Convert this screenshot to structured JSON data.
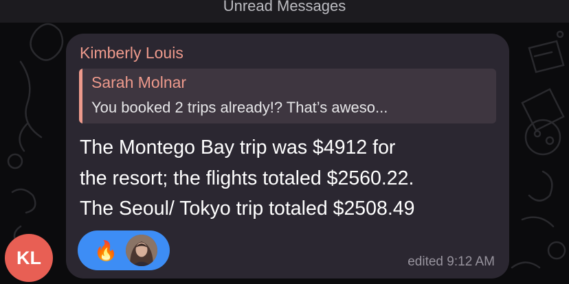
{
  "unread_bar": {
    "label": "Unread Messages"
  },
  "sender": {
    "initials": "KL",
    "name": "Kimberly Louis"
  },
  "reply": {
    "author": "Sarah Molnar",
    "preview": "You booked 2 trips already!? That’s aweso..."
  },
  "message": {
    "lines": [
      "The Montego Bay trip was $4912 for",
      "the resort; the flights totaled $2560.22.",
      "The Seoul/ Tokyo trip totaled $2508.49"
    ],
    "status": "edited 9:12 AM"
  },
  "reactions": {
    "emoji": "🔥"
  },
  "colors": {
    "accent_name": "#ee9a8c",
    "avatar_bg": "#e85f54",
    "bubble_bg": "#2b2731",
    "reaction_bg": "#3d8df5"
  }
}
